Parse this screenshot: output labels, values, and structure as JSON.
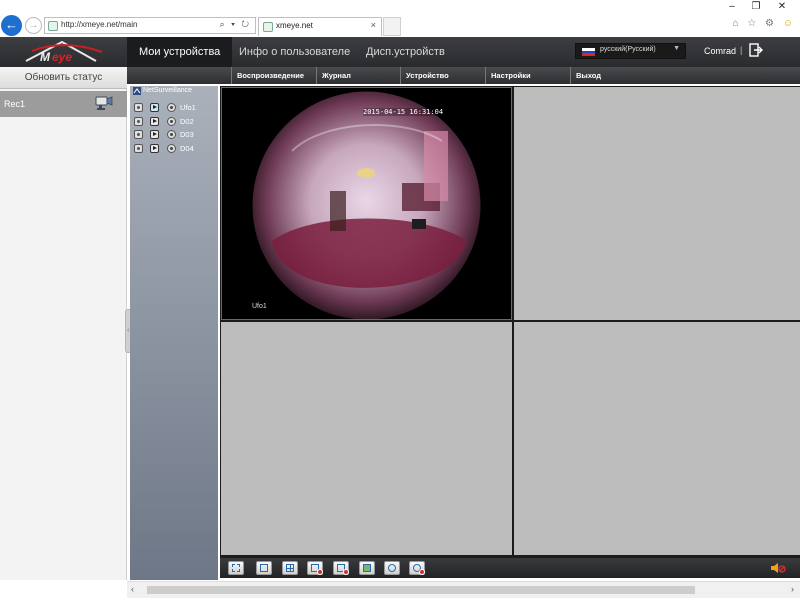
{
  "browser": {
    "url": "http://xmeye.net/main",
    "tab_title": "xmeye.net",
    "window_controls": [
      "–",
      "❐",
      "✕"
    ],
    "addr_icons": "⌕ ▾ ↻",
    "tab_close": "×",
    "nav_back": "←",
    "nav_forward": "→",
    "toolbar_icons": [
      "home-icon",
      "star-icon",
      "gear-icon",
      "smiley-icon"
    ]
  },
  "header": {
    "logo_text": "XMeye",
    "nav": [
      {
        "label": "Мои устройства",
        "active": true
      },
      {
        "label": "Инфо о пользователе",
        "active": false
      },
      {
        "label": "Дисп.устройств",
        "active": false
      }
    ],
    "language": "русский(Русский)",
    "username": "Comrad",
    "separator": "|"
  },
  "sidebar": {
    "refresh_label": "Обновить статус",
    "devices": [
      {
        "name": "Rec1"
      }
    ],
    "collapse_glyph": "‹‹"
  },
  "player_menu": {
    "items": [
      "Воспроизведение",
      "Журнал",
      "Устройство",
      "Настройки",
      "Выход"
    ]
  },
  "channel_tree": {
    "root": "NetSurveillance",
    "channels": [
      {
        "name": "Ufo1",
        "active": true
      },
      {
        "name": "D02",
        "active": false
      },
      {
        "name": "D03",
        "active": false
      },
      {
        "name": "D04",
        "active": false
      }
    ]
  },
  "video": {
    "live_channel": {
      "timestamp": "2015-04-15 16:31:04",
      "channel_name": "Ufo1"
    },
    "colors": {
      "empty_cell": "#bdbdbd",
      "active_border": "#3a8a3a"
    }
  },
  "toolbar": {
    "buttons": [
      "fullscreen-icon",
      "single-view-icon",
      "quad-view-icon",
      "record-icon",
      "stop-record-icon",
      "snapshot-icon",
      "play-all-icon",
      "stop-all-icon"
    ]
  },
  "scrollbar": {
    "left_arrow": "‹",
    "right_arrow": "›"
  }
}
